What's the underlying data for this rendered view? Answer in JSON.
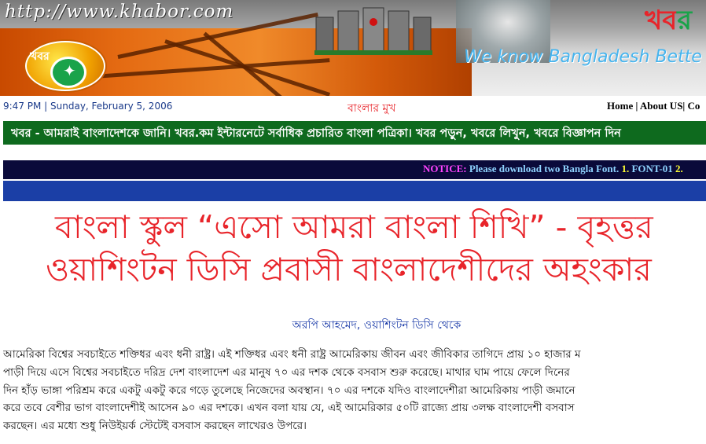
{
  "banner": {
    "url": "http://www.khabor.com",
    "logo_text": "খবর",
    "tagline": "We know Bangladesh Bette",
    "brand_bn_red": "খব",
    "brand_bn_green": "র"
  },
  "infobar": {
    "datetime": "9:47 PM | Sunday, February 5, 2006",
    "center_link": "বাংলার মুখ",
    "nav": {
      "home": "Home",
      "sep1": " | ",
      "about": "About US",
      "sep2": "| ",
      "contact": "Co"
    }
  },
  "ticker": {
    "text": "খবর - আমরাই বাংলাদেশকে জানি। খবর.কম ইন্টারনেটে সর্বাধিক প্রচারিত বাংলা পত্রিকা। খবর পড়ুন, খবরে লিখুন, খবরে বিজ্ঞাপন দিন"
  },
  "notice": {
    "label": "NOTICE:",
    "message": " Please download two Bangla Font. ",
    "num1": "1.",
    "font1": " FONT-01 ",
    "num2": "2."
  },
  "article": {
    "headline_line1": "বাংলা স্কুল “এসো আমরা বাংলা শিখি” - বৃহত্তর",
    "headline_line2": "ওয়াশিংটন ডিসি প্রবাসী বাংলাদেশীদের অহংকার",
    "byline": "অরপি আহমেদ, ওয়াশিংটন ডিসি থেকে",
    "body_lines": [
      "আমেরিকা বিশ্বের সবচাইতে শক্তিধর এবং ধনী রাষ্ট্র। এই শক্তিধর এবং ধনী রাষ্ট্র আমেরিকায় জীবন এবং জীবিকার তাগিদে প্রায় ১০ হাজার ম",
      "পাড়ী দিয়ে এসে বিশ্বের সবচাইতে দরিদ্র দেশ বাংলাদেশ এর মানুষ ৭০ এর দশক থেকে বসবাস শুরু করেছে। মাথার ঘাম পায়ে ফেলে দিনের",
      "দিন হাঁড় ভাঙ্গা পরিশ্রম করে একটু একটু করে গড়ে তুলেছে নিজেদের অবস্থান। ৭০ এর দশকে যদিও বাংলাদেশীরা আমেরিকায় পাড়ী জমানে",
      "করে তবে বেশীর ভাগ বাংলাদেশীই আসেন ৯০ এর দশকে। এখন বলা যায় যে, এই আমেরিকার ৫০টি রাজ্যে প্রায় ৩লক্ষ বাংলাদেশী বসবাস",
      "করছেন। এর মধ্যে শুধু নিউইয়র্ক স্টেটেই বসবাস করছেন লাখেরও উপরে।"
    ]
  }
}
